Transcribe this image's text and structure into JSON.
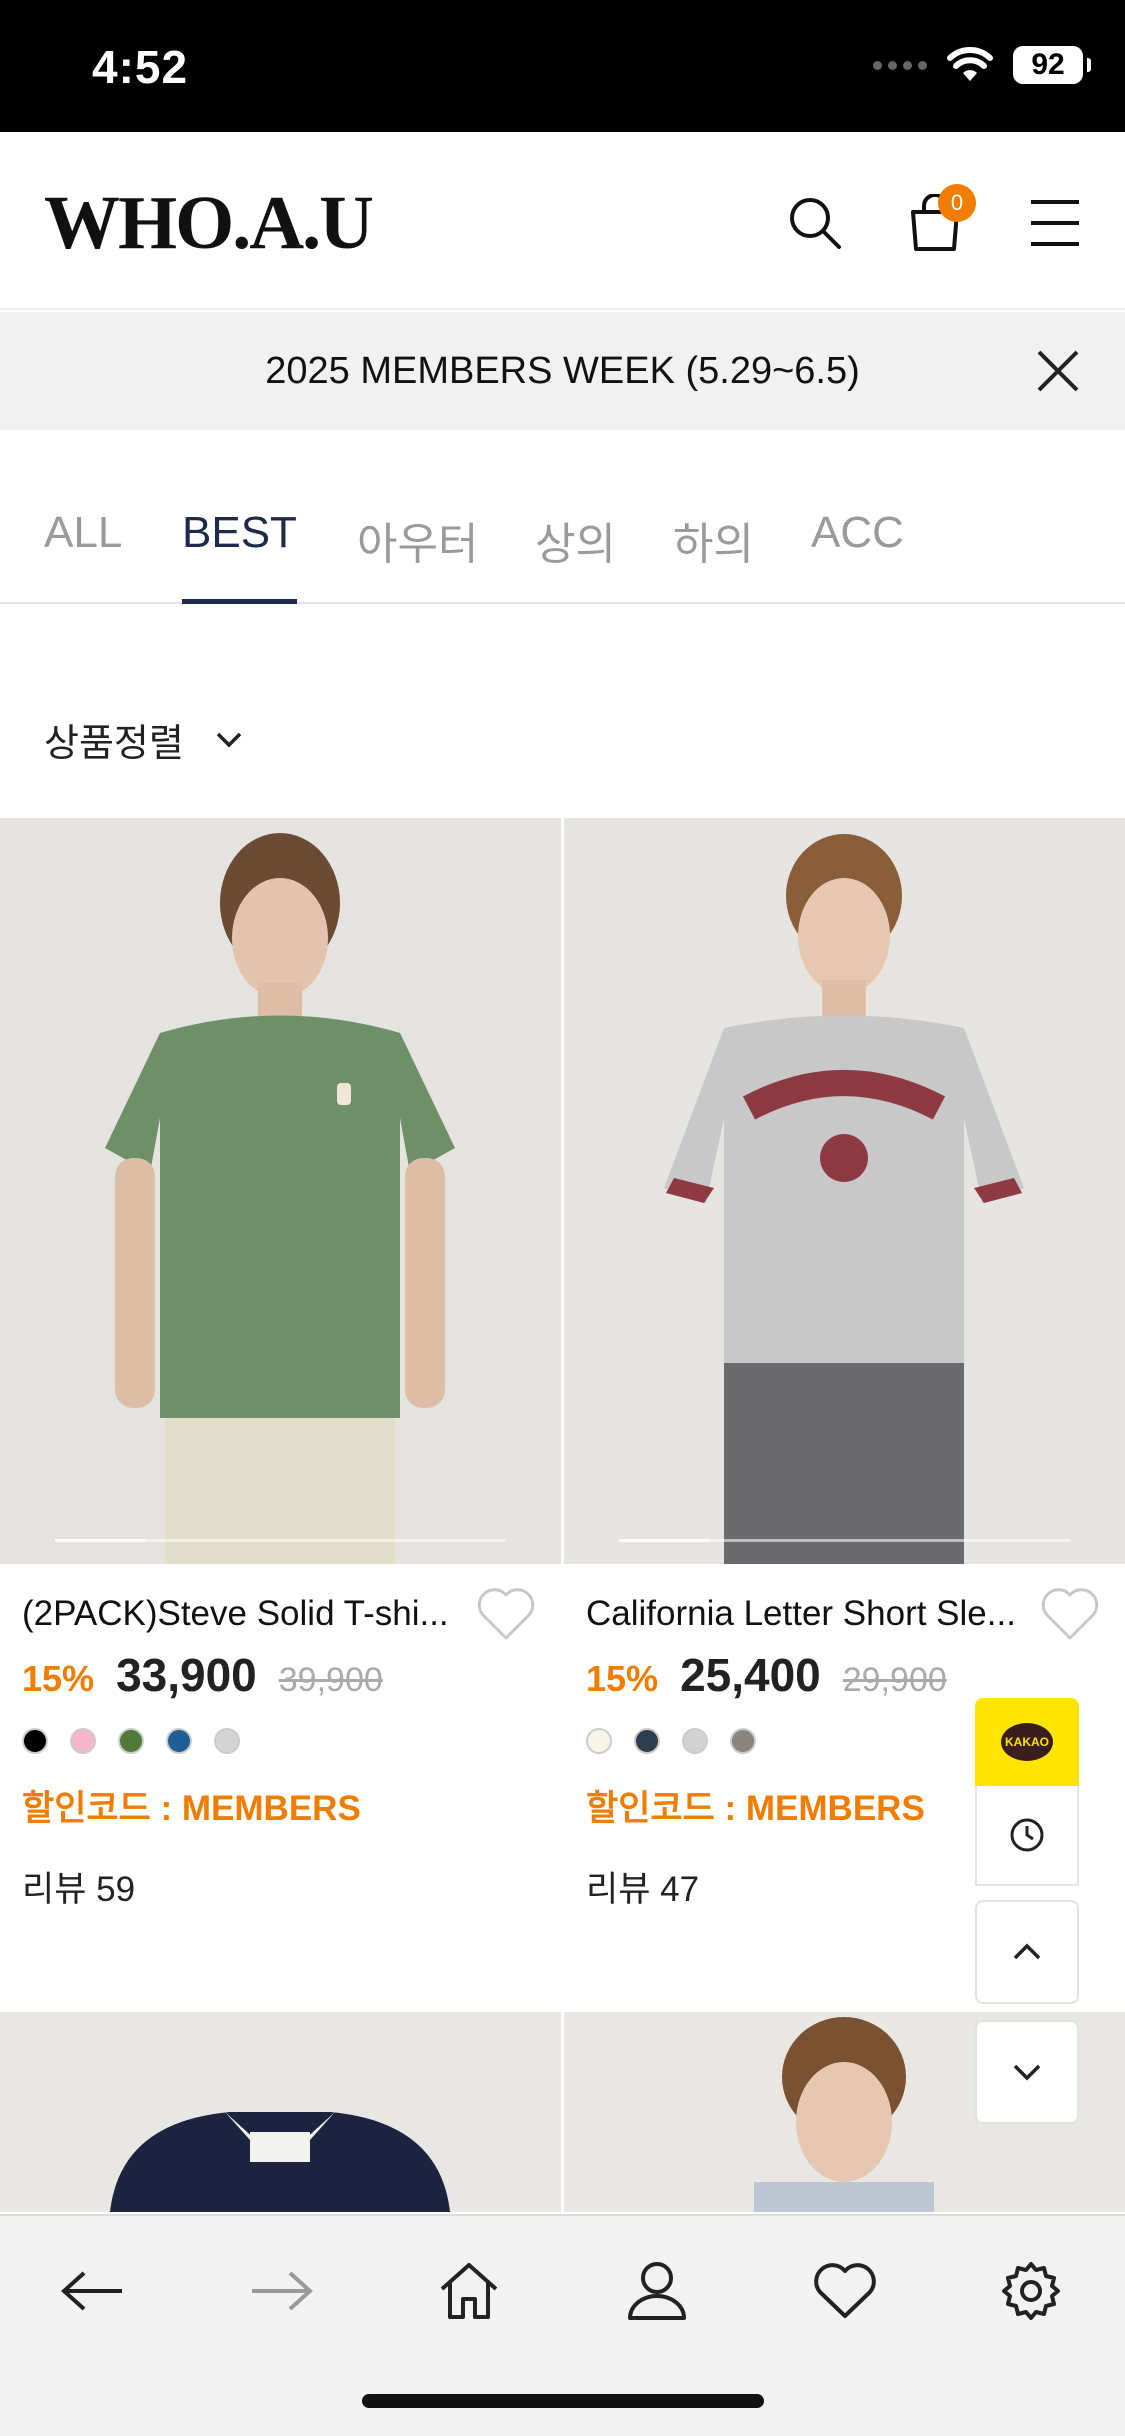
{
  "status_bar": {
    "time": "4:52",
    "battery": "92"
  },
  "header": {
    "logo": "WHO.A.U",
    "cart_count": "0"
  },
  "promo": {
    "text": "2025 MEMBERS WEEK (5.29~6.5)"
  },
  "tabs": [
    {
      "label": "ALL",
      "active": false
    },
    {
      "label": "BEST",
      "active": true
    },
    {
      "label": "아우터",
      "active": false
    },
    {
      "label": "상의",
      "active": false
    },
    {
      "label": "하의",
      "active": false
    },
    {
      "label": "ACC",
      "active": false
    }
  ],
  "sort": {
    "label": "상품정렬"
  },
  "products": [
    {
      "name": "(2PACK)Steve Solid T-shi...",
      "discount": "15%",
      "price": "33,900",
      "original_price": "39,900",
      "swatches": [
        "#000000",
        "#f4b6c8",
        "#4f7a3a",
        "#1f5f96",
        "#d4d4d4"
      ],
      "code": "할인코드 : MEMBERS",
      "review": "리뷰 59"
    },
    {
      "name": "California Letter Short Sle...",
      "discount": "15%",
      "price": "25,400",
      "original_price": "29,900",
      "swatches": [
        "#f8f4e6",
        "#2f3e4e",
        "#d2d2d2",
        "#8a847d"
      ],
      "code": "할인코드 : MEMBERS",
      "review": "리뷰 47"
    }
  ],
  "floating": {
    "kakao_label": "KAKAO"
  },
  "colors": {
    "accent": "#f07c00",
    "tab_active": "#1d2a4a",
    "kakao": "#fee500"
  }
}
